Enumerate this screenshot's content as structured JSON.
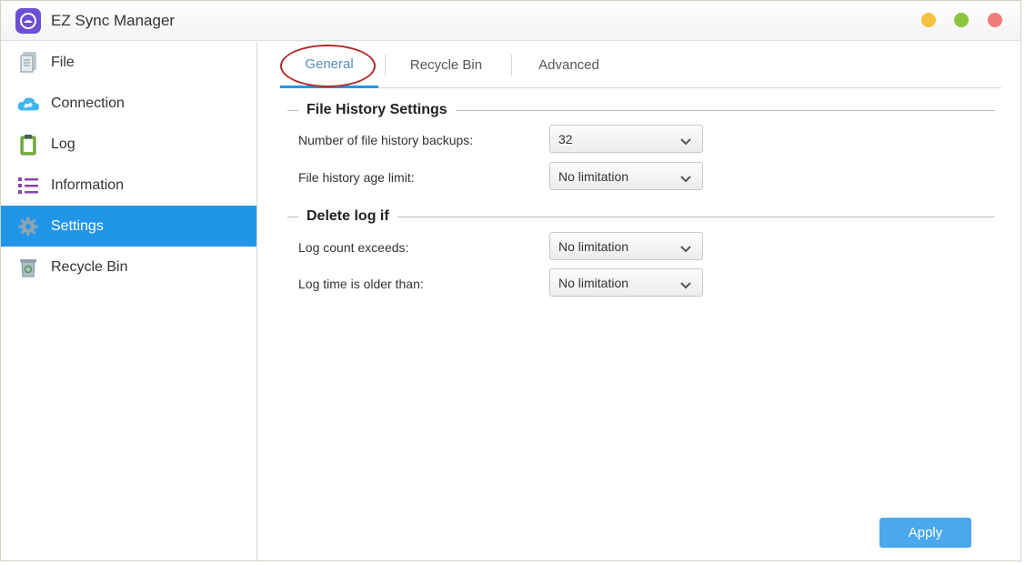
{
  "window": {
    "title": "EZ Sync Manager",
    "controls": [
      "minimize",
      "maximize",
      "close"
    ],
    "colors": {
      "minimize": "#f5c242",
      "maximize": "#8cc63f",
      "close": "#f07b7b"
    }
  },
  "sidebar": {
    "items": [
      {
        "label": "File",
        "icon": "file-icon",
        "active": false
      },
      {
        "label": "Connection",
        "icon": "cloud-sync-icon",
        "active": false
      },
      {
        "label": "Log",
        "icon": "clipboard-icon",
        "active": false
      },
      {
        "label": "Information",
        "icon": "list-icon",
        "active": false
      },
      {
        "label": "Settings",
        "icon": "gear-icon",
        "active": true
      },
      {
        "label": "Recycle Bin",
        "icon": "recycle-bin-icon",
        "active": false
      }
    ],
    "active_color": "#2196e9"
  },
  "tabs": [
    {
      "label": "General",
      "active": true
    },
    {
      "label": "Recycle Bin",
      "active": false
    },
    {
      "label": "Advanced",
      "active": false
    }
  ],
  "sections": {
    "file_history": {
      "title": "File History Settings",
      "rows": [
        {
          "label": "Number of file history backups:",
          "value": "32"
        },
        {
          "label": "File history age limit:",
          "value": "No limitation"
        }
      ]
    },
    "delete_log": {
      "title": "Delete log if",
      "rows": [
        {
          "label": "Log count exceeds:",
          "value": "No limitation"
        },
        {
          "label": "Log time is older than:",
          "value": "No limitation"
        }
      ]
    }
  },
  "apply_label": "Apply"
}
